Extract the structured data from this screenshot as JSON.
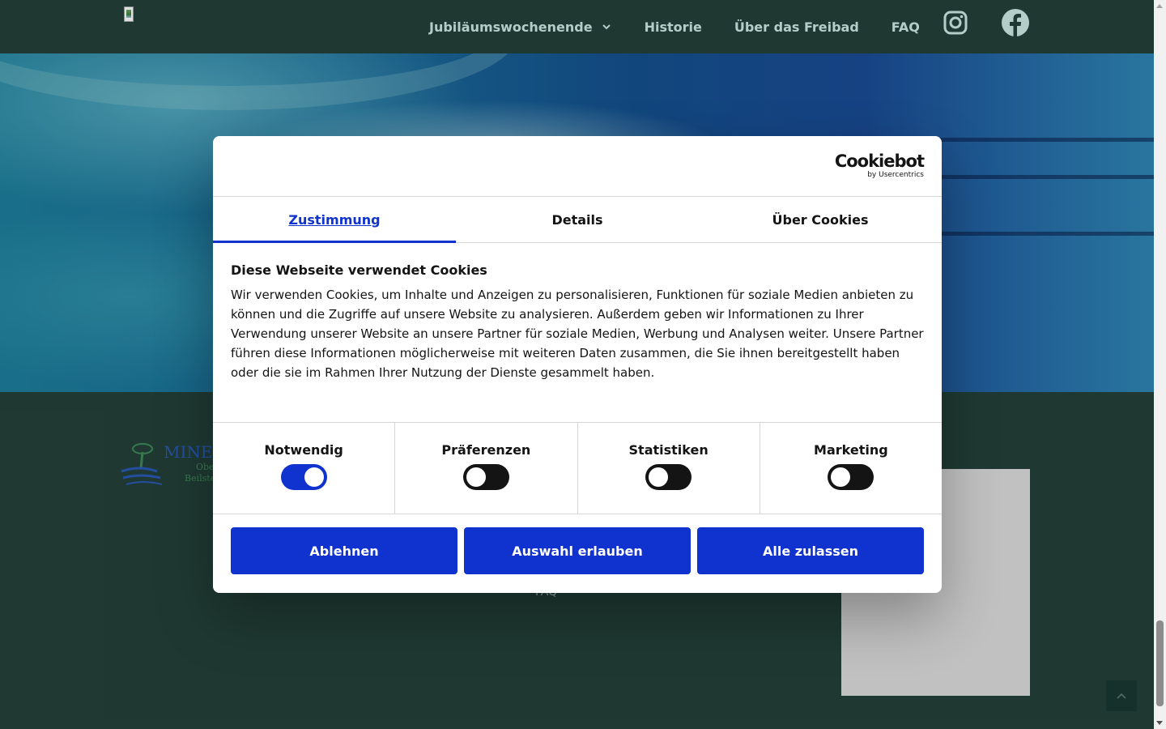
{
  "header": {
    "nav": [
      {
        "label": "Jubiläumswochenende",
        "has_dropdown": true
      },
      {
        "label": "Historie"
      },
      {
        "label": "Über das Freibad"
      },
      {
        "label": "FAQ"
      }
    ],
    "social": [
      "instagram-icon",
      "facebook-icon"
    ],
    "nav_color": "#cdeae4",
    "bg_color": "#24413a"
  },
  "footer": {
    "logo_line1": "MINER",
    "logo_line2": "Obe",
    "logo_line3": "Beilste",
    "links": [
      "FAQ"
    ]
  },
  "dialog": {
    "brand": "Cookiebot",
    "brand_sub": "by Usercentrics",
    "tabs": [
      {
        "label": "Zustimmung",
        "active": true
      },
      {
        "label": "Details",
        "active": false
      },
      {
        "label": "Über Cookies",
        "active": false
      }
    ],
    "heading": "Diese Webseite verwendet Cookies",
    "text": "Wir verwenden Cookies, um Inhalte und Anzeigen zu personalisieren, Funktionen für soziale Medien anbieten zu können und die Zugriffe auf unsere Website zu analysieren. Außerdem geben wir Informationen zu Ihrer Verwendung unserer Website an unsere Partner für soziale Medien, Werbung und Analysen weiter. Unsere Partner führen diese Informationen möglicherweise mit weiteren Daten zusammen, die Sie ihnen bereitgestellt haben oder die sie im Rahmen Ihrer Nutzung der Dienste gesammelt haben.",
    "toggles": [
      {
        "label": "Notwendig",
        "on": true
      },
      {
        "label": "Präferenzen",
        "on": false
      },
      {
        "label": "Statistiken",
        "on": false
      },
      {
        "label": "Marketing",
        "on": false
      }
    ],
    "buttons": {
      "decline": "Ablehnen",
      "allow_selection": "Auswahl erlauben",
      "allow_all": "Alle zulassen"
    },
    "accent_color": "#1032cf"
  }
}
